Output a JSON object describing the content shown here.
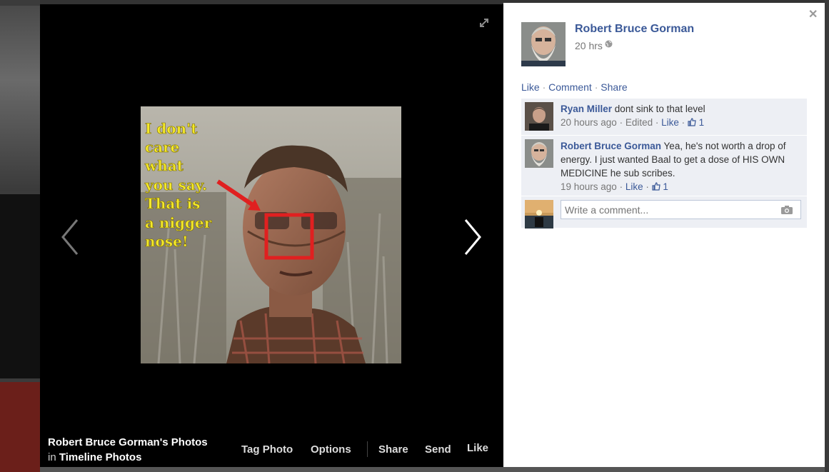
{
  "stage": {
    "album_title": "Robert Bruce Gorman's Photos",
    "album_in": "in",
    "album_name": "Timeline Photos",
    "footer_actions": [
      "Tag Photo",
      "Options",
      "Share",
      "Send",
      "Like"
    ],
    "photo_caption_lines": [
      "I don't",
      "care",
      "what",
      "you say.",
      "That is",
      "a nigger",
      "nose!"
    ],
    "photo_caption_color": "#f5ea2a",
    "annotation_color": "#e02020"
  },
  "panel": {
    "author": "Robert Bruce Gorman",
    "time": "20 hrs",
    "actions": {
      "like": "Like",
      "comment": "Comment",
      "share": "Share",
      "sep": "·"
    },
    "comments": [
      {
        "name": "Ryan Miller",
        "text": "dont sink to that level",
        "meta": "20 hours ago",
        "edited": "Edited",
        "like": "Like",
        "likes": "1"
      },
      {
        "name": "Robert Bruce Gorman",
        "text": "Yea, he's not worth a drop of energy. I just wanted Baal to get a dose of HIS OWN MEDICINE he sub scribes.",
        "meta": "19 hours ago",
        "like": "Like",
        "likes": "1"
      }
    ],
    "write_placeholder": "Write a comment..."
  },
  "colors": {
    "link": "#3b5998",
    "comment_bg": "#edeff4"
  }
}
